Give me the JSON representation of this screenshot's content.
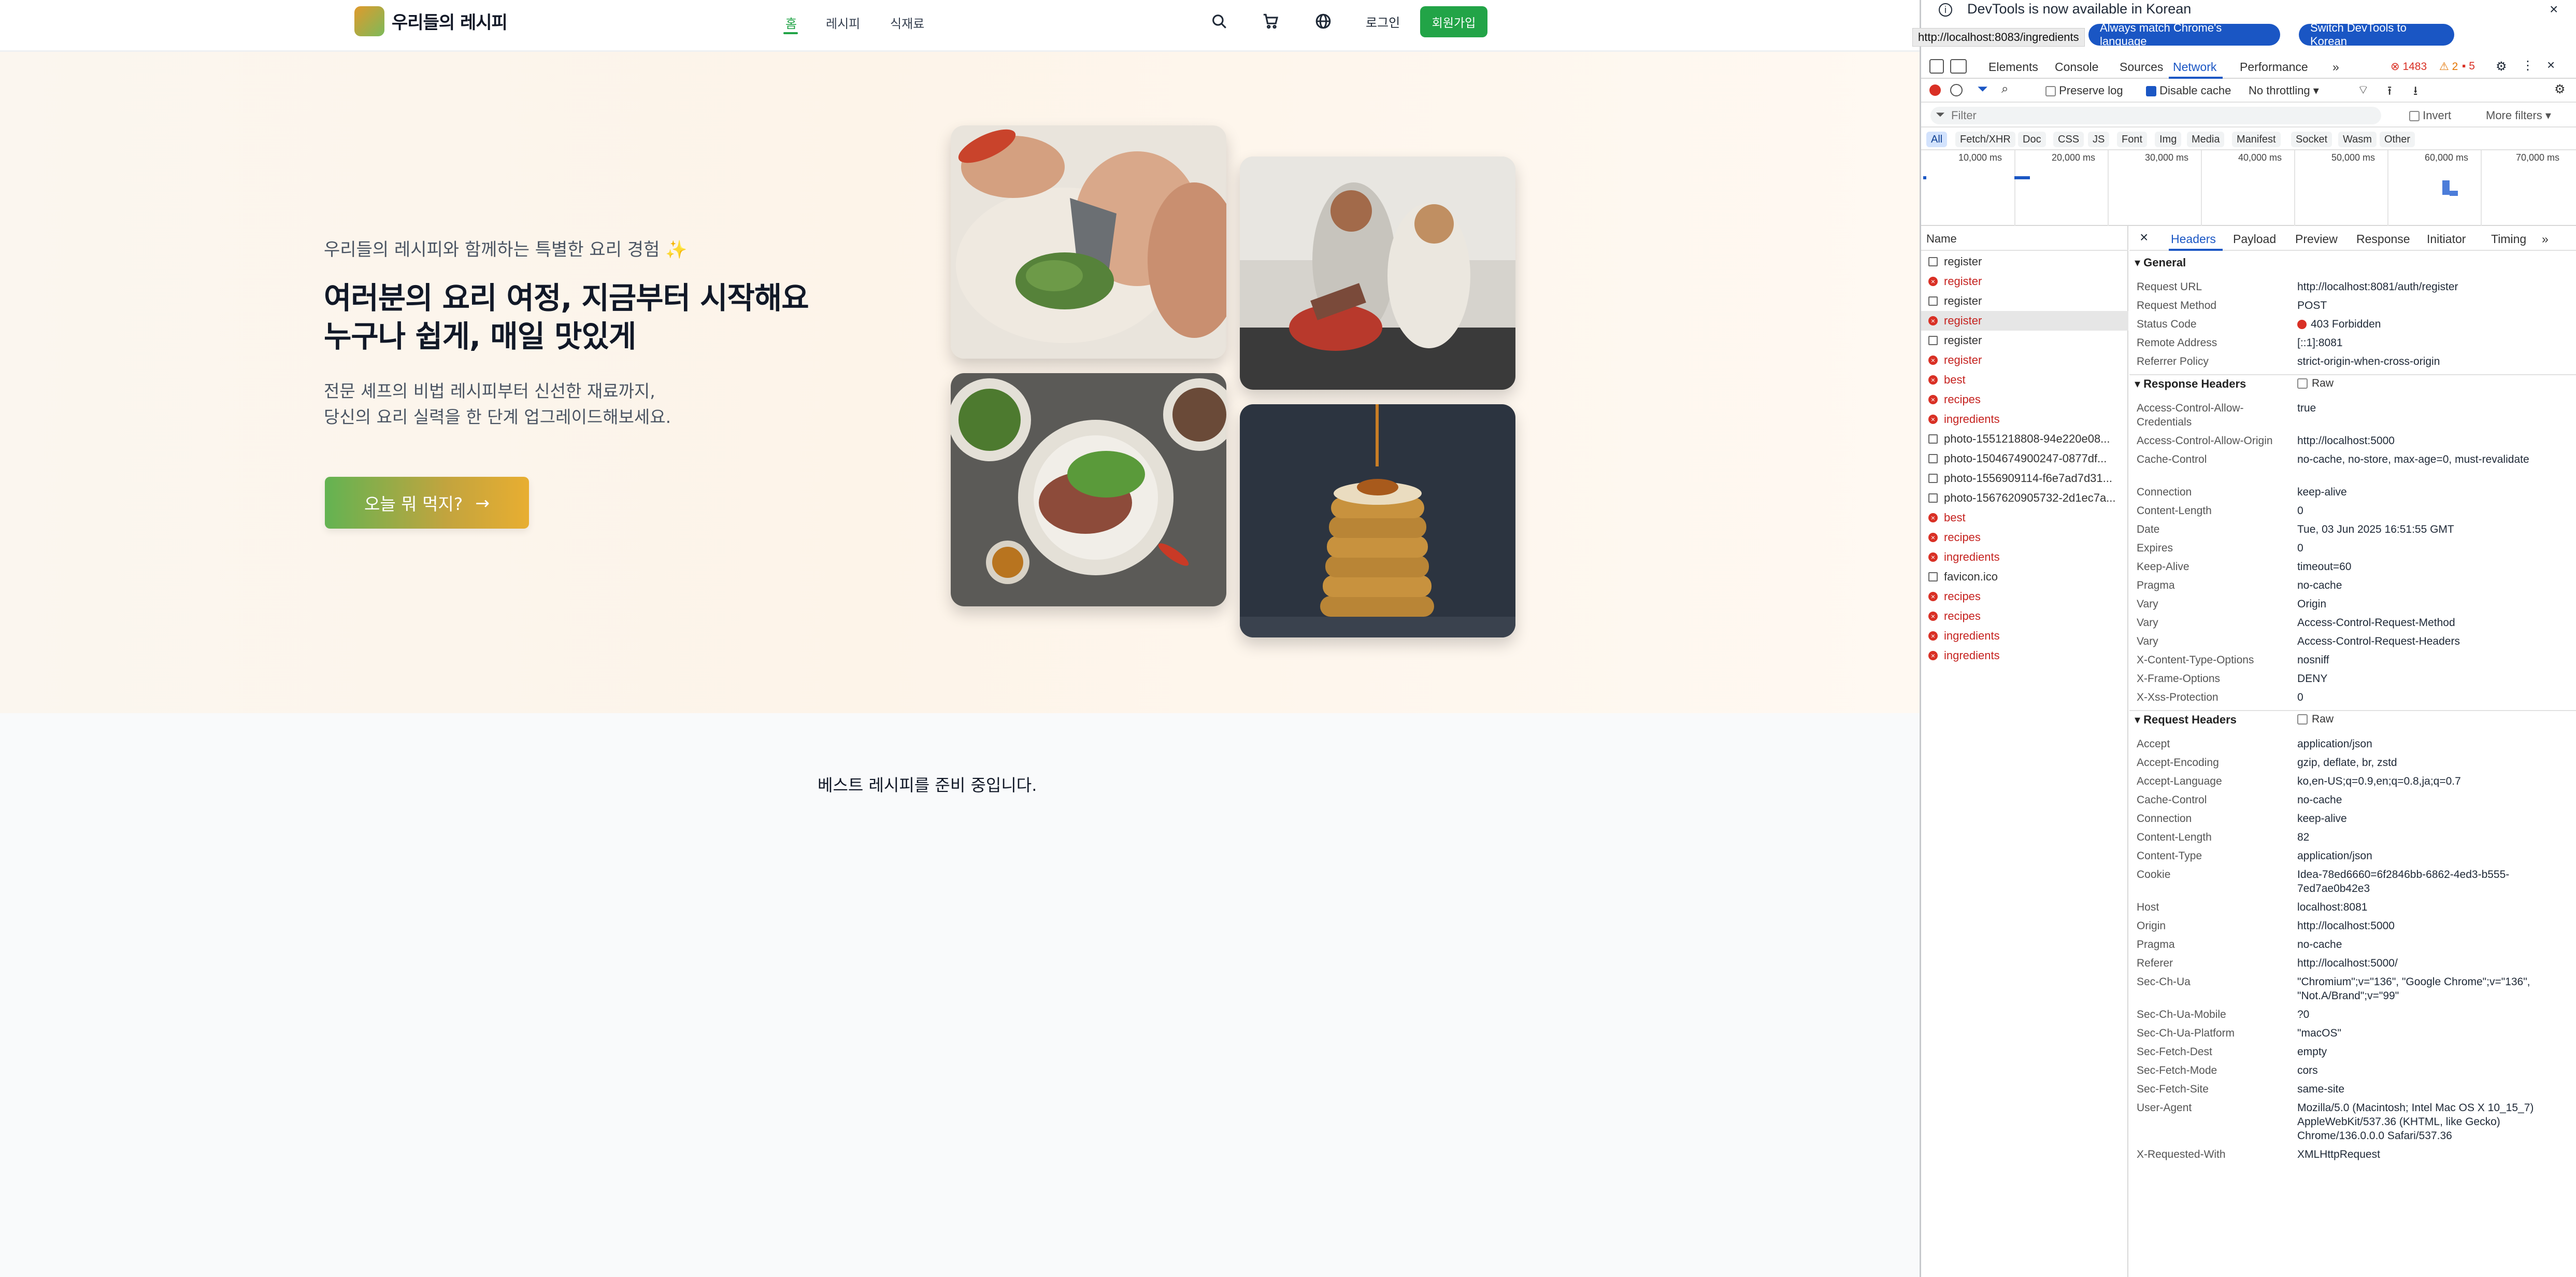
{
  "site": {
    "brand": "우리들의 레시피",
    "nav": {
      "home": "홈",
      "recipes": "레시피",
      "ingredients": "식재료"
    },
    "login": "로그인",
    "signup": "회원가입",
    "hero": {
      "tagline": "우리들의 레시피와 함께하는 특별한 요리 경험 ✨",
      "title_line1": "여러분의 요리 여정, 지금부터 시작해요",
      "title_line2": "누구나 쉽게, 매일 맛있게",
      "desc_line1": "전문 셰프의 비법 레시피부터 신선한 재료까지,",
      "desc_line2": "당신의 요리 실력을 한 단계 업그레이드해보세요.",
      "cta": "오늘 뭐 먹지?",
      "cta_arrow": "→"
    },
    "best_message": "베스트 레시피를 준비 중입니다."
  },
  "devtools": {
    "banner": {
      "message": "DevTools is now available in Korean",
      "tooltip": "http://localhost:8083/ingredients",
      "btn_match": "Always match Chrome's language",
      "btn_switch": "Switch DevTools to Korean",
      "close": "×"
    },
    "tabs": [
      "Elements",
      "Console",
      "Sources",
      "Network",
      "Performance",
      "»"
    ],
    "counts": {
      "errors": "1483",
      "warnings": "2",
      "issues": "5"
    },
    "toolbar": {
      "preserve_log": "Preserve log",
      "disable_cache": "Disable cache",
      "throttling": "No throttling"
    },
    "filter": {
      "placeholder": "Filter",
      "invert": "Invert",
      "more_filters": "More filters ▾"
    },
    "types": [
      "All",
      "Fetch/XHR",
      "Doc",
      "CSS",
      "JS",
      "Font",
      "Img",
      "Media",
      "Manifest",
      "Socket",
      "Wasm",
      "Other"
    ],
    "overview_ticks": [
      "10,000 ms",
      "20,000 ms",
      "30,000 ms",
      "40,000 ms",
      "50,000 ms",
      "60,000 ms",
      "70,000 ms"
    ],
    "list_header": "Name",
    "requests": [
      {
        "name": "register",
        "error": false
      },
      {
        "name": "register",
        "error": true
      },
      {
        "name": "register",
        "error": false
      },
      {
        "name": "register",
        "error": true,
        "selected": true
      },
      {
        "name": "register",
        "error": false
      },
      {
        "name": "register",
        "error": true
      },
      {
        "name": "best",
        "error": true
      },
      {
        "name": "recipes",
        "error": true
      },
      {
        "name": "ingredients",
        "error": true
      },
      {
        "name": "photo-1551218808-94e220e08...",
        "error": false
      },
      {
        "name": "photo-1504674900247-0877df...",
        "error": false
      },
      {
        "name": "photo-1556909114-f6e7ad7d31...",
        "error": false
      },
      {
        "name": "photo-1567620905732-2d1ec7a...",
        "error": false
      },
      {
        "name": "best",
        "error": true
      },
      {
        "name": "recipes",
        "error": true
      },
      {
        "name": "ingredients",
        "error": true
      },
      {
        "name": "favicon.ico",
        "error": false
      },
      {
        "name": "recipes",
        "error": true
      },
      {
        "name": "recipes",
        "error": true
      },
      {
        "name": "ingredients",
        "error": true
      },
      {
        "name": "ingredients",
        "error": true
      }
    ],
    "detail_tabs": [
      "Headers",
      "Payload",
      "Preview",
      "Response",
      "Initiator",
      "Timing",
      "»"
    ],
    "general_title": "▾ General",
    "general": [
      {
        "k": "Request URL",
        "v": "http://localhost:8081/auth/register"
      },
      {
        "k": "Request Method",
        "v": "POST"
      },
      {
        "k": "Status Code",
        "v": "403 Forbidden"
      },
      {
        "k": "Remote Address",
        "v": "[::1]:8081"
      },
      {
        "k": "Referrer Policy",
        "v": "strict-origin-when-cross-origin"
      }
    ],
    "response_title": "▾ Response Headers",
    "raw": "Raw",
    "response": [
      {
        "k": "Access-Control-Allow-Credentials",
        "v": "true"
      },
      {
        "k": "Access-Control-Allow-Origin",
        "v": "http://localhost:5000"
      },
      {
        "k": "Cache-Control",
        "v": "no-cache, no-store, max-age=0, must-revalidate"
      },
      {
        "k": "Connection",
        "v": "keep-alive"
      },
      {
        "k": "Content-Length",
        "v": "0"
      },
      {
        "k": "Date",
        "v": "Tue, 03 Jun 2025 16:51:55 GMT"
      },
      {
        "k": "Expires",
        "v": "0"
      },
      {
        "k": "Keep-Alive",
        "v": "timeout=60"
      },
      {
        "k": "Pragma",
        "v": "no-cache"
      },
      {
        "k": "Vary",
        "v": "Origin"
      },
      {
        "k": "Vary",
        "v": "Access-Control-Request-Method"
      },
      {
        "k": "Vary",
        "v": "Access-Control-Request-Headers"
      },
      {
        "k": "X-Content-Type-Options",
        "v": "nosniff"
      },
      {
        "k": "X-Frame-Options",
        "v": "DENY"
      },
      {
        "k": "X-Xss-Protection",
        "v": "0"
      }
    ],
    "request_title": "▾ Request Headers",
    "request": [
      {
        "k": "Accept",
        "v": "application/json"
      },
      {
        "k": "Accept-Encoding",
        "v": "gzip, deflate, br, zstd"
      },
      {
        "k": "Accept-Language",
        "v": "ko,en-US;q=0.9,en;q=0.8,ja;q=0.7"
      },
      {
        "k": "Cache-Control",
        "v": "no-cache"
      },
      {
        "k": "Connection",
        "v": "keep-alive"
      },
      {
        "k": "Content-Length",
        "v": "82"
      },
      {
        "k": "Content-Type",
        "v": "application/json"
      },
      {
        "k": "Cookie",
        "v": "Idea-78ed6660=6f2846bb-6862-4ed3-b555-7ed7ae0b42e3"
      },
      {
        "k": "Host",
        "v": "localhost:8081"
      },
      {
        "k": "Origin",
        "v": "http://localhost:5000"
      },
      {
        "k": "Pragma",
        "v": "no-cache"
      },
      {
        "k": "Referer",
        "v": "http://localhost:5000/"
      },
      {
        "k": "Sec-Ch-Ua",
        "v": "\"Chromium\";v=\"136\", \"Google Chrome\";v=\"136\", \"Not.A/Brand\";v=\"99\""
      },
      {
        "k": "Sec-Ch-Ua-Mobile",
        "v": "?0"
      },
      {
        "k": "Sec-Ch-Ua-Platform",
        "v": "\"macOS\""
      },
      {
        "k": "Sec-Fetch-Dest",
        "v": "empty"
      },
      {
        "k": "Sec-Fetch-Mode",
        "v": "cors"
      },
      {
        "k": "Sec-Fetch-Site",
        "v": "same-site"
      },
      {
        "k": "User-Agent",
        "v": "Mozilla/5.0 (Macintosh; Intel Mac OS X 10_15_7) AppleWebKit/537.36 (KHTML, like Gecko) Chrome/136.0.0.0 Safari/537.36"
      },
      {
        "k": "X-Requested-With",
        "v": "XMLHttpRequest"
      }
    ]
  }
}
